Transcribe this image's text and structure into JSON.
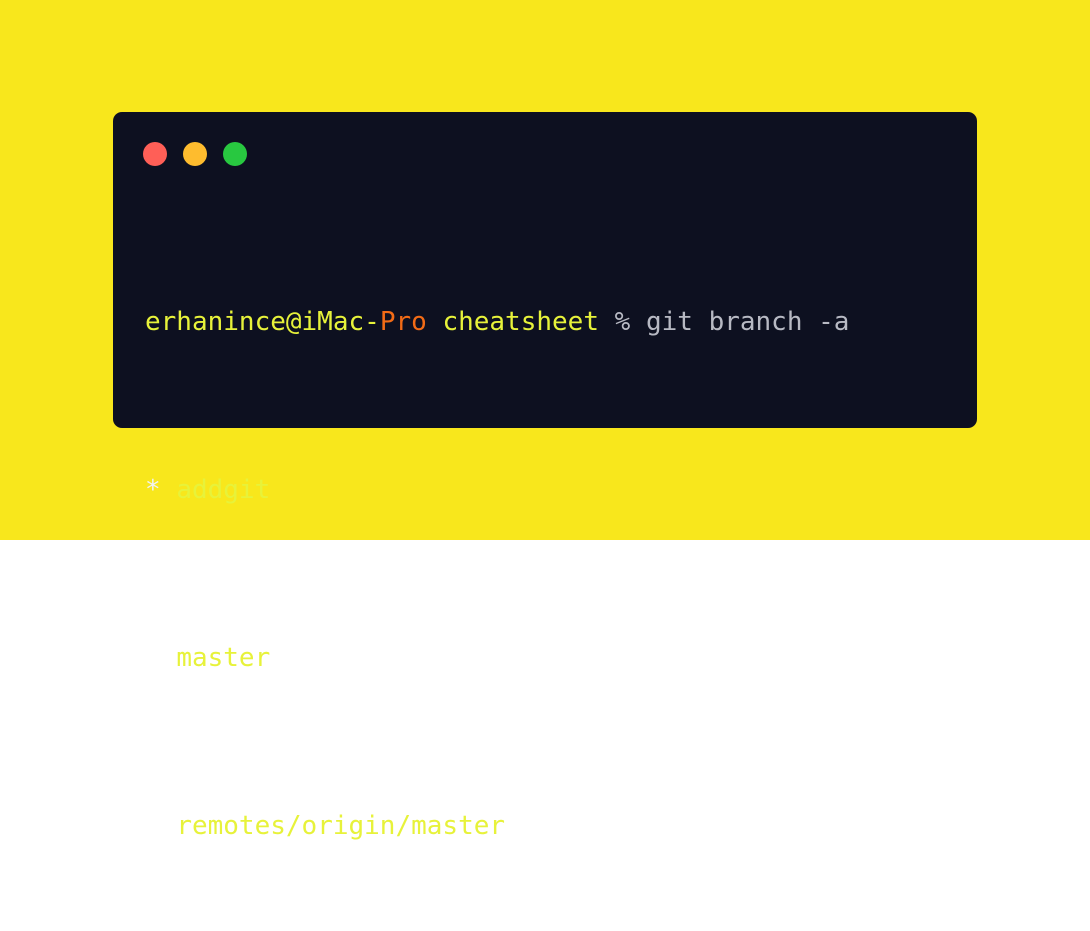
{
  "colors": {
    "background": "#F8E71C",
    "terminal_bg": "#0D1020",
    "dot_red": "#FF5F57",
    "dot_yellow": "#FEBC2E",
    "dot_green": "#28C840",
    "prompt_yellow": "#E7F23A",
    "prompt_orange": "#F26B16",
    "command_gray": "#B7B9C3",
    "star_white": "#F1F3F5",
    "branch_yellow": "#E7F23A"
  },
  "window_controls": [
    "close-dot",
    "minimize-dot",
    "maximize-dot"
  ],
  "terminal": {
    "prompt": {
      "user_host_prefix": "erhanince@iMac-",
      "host_suffix": "Pro",
      "space_before_dir": " ",
      "directory": "cheatsheet",
      "symbol": " % "
    },
    "command": "git branch -a",
    "output": [
      {
        "marker": "*",
        "gap": " ",
        "name": "addgit"
      },
      {
        "marker": " ",
        "gap": " ",
        "name": "master"
      },
      {
        "marker": " ",
        "gap": " ",
        "name": "remotes/origin/master"
      }
    ]
  }
}
